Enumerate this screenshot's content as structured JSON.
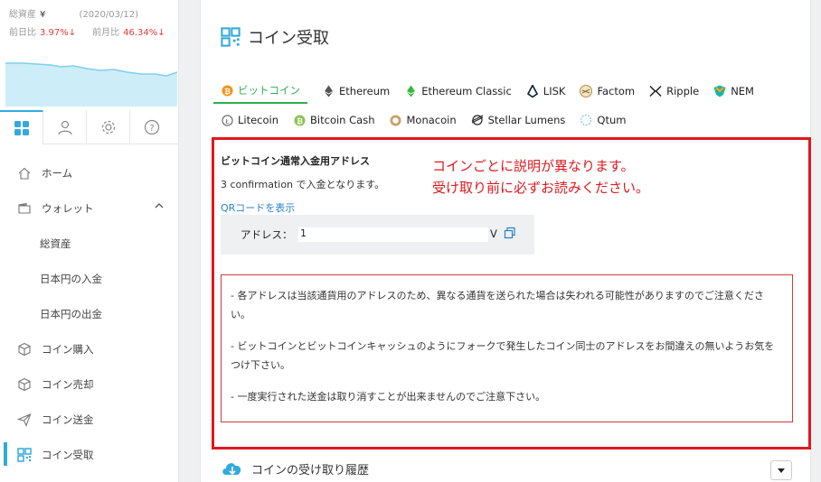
{
  "sidebar": {
    "assets": {
      "total_label": "総資産",
      "total_value": "¥",
      "date": "(2020/03/12)",
      "day_change_label": "前日比",
      "day_change_value": "3.97%↓",
      "month_change_label": "前月比",
      "month_change_value": "46.34%↓"
    },
    "nav": [
      {
        "label": "ホーム",
        "icon": "home-icon"
      },
      {
        "label": "ウォレット",
        "icon": "wallet-icon"
      },
      {
        "label": "総資産"
      },
      {
        "label": "日本円の入金"
      },
      {
        "label": "日本円の出金"
      },
      {
        "label": "コイン購入",
        "icon": "cube-icon"
      },
      {
        "label": "コイン売却",
        "icon": "cube-icon"
      },
      {
        "label": "コイン送金",
        "icon": "send-icon"
      },
      {
        "label": "コイン受取",
        "icon": "qr-icon"
      }
    ]
  },
  "main": {
    "title": "コイン受取",
    "coin_tabs_row1": [
      "ビットコイン",
      "Ethereum",
      "Ethereum Classic",
      "LISK",
      "Factom",
      "Ripple",
      "NEM"
    ],
    "coin_tabs_row2": [
      "Litecoin",
      "Bitcoin Cash",
      "Monacoin",
      "Stellar Lumens",
      "Qtum"
    ],
    "address_title": "ビットコイン通常入金用アドレス",
    "confirmation": "3 confirmation で入金となります。",
    "qr_link": "QRコードを表示",
    "address_label": "アドレス：",
    "address_value": "1",
    "address_end": "V",
    "annotation_line1": "コインごとに説明が異なります。",
    "annotation_line2": "受け取り前に必ずお読みください。",
    "warnings": [
      "- 各アドレスは当該通貨用のアドレスのため、異なる通貨を送られた場合は失われる可能性がありますのでご注意ください。",
      "- ビットコインとビットコインキャッシュのようにフォークで発生したコイン同士のアドレスをお間違えの無いようお気をつけ下さい。",
      "- 一度実行された送金は取り消すことが出来ませんのでご注意下さい。"
    ],
    "history_label": "コインの受け取り履歴"
  },
  "colors": {
    "accent_blue": "#33aadd",
    "active_green": "#2fae53",
    "alert_red": "#e0181d"
  }
}
